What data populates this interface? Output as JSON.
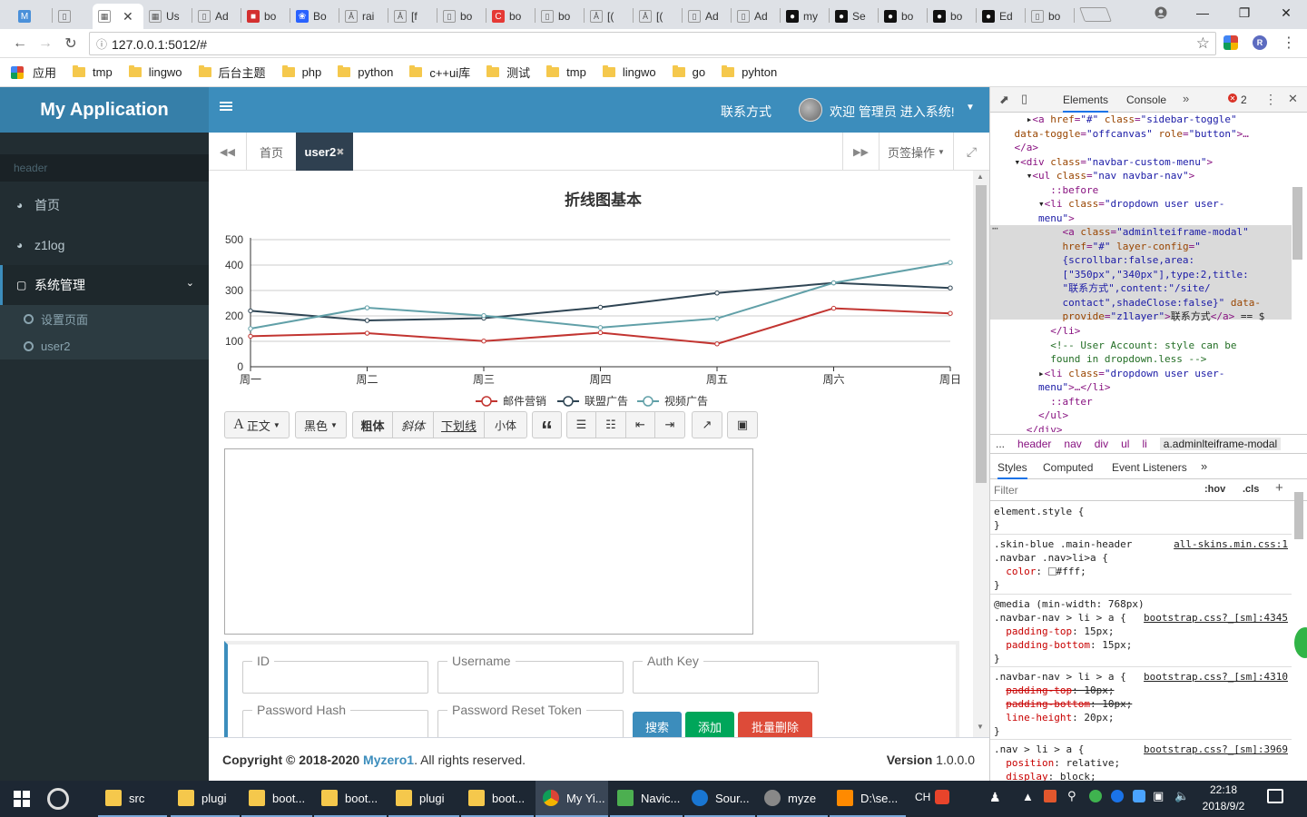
{
  "browser": {
    "tabs": [
      {
        "label": "",
        "icon": "m-logo-icon"
      },
      {
        "label": "",
        "icon": "page-icon"
      },
      {
        "label": "",
        "icon": "grid-icon",
        "active": true
      },
      {
        "label": "Us",
        "icon": "windows-icon"
      },
      {
        "label": "Ad",
        "icon": "page-icon"
      },
      {
        "label": "bo",
        "icon": "red-square-icon"
      },
      {
        "label": "Bo",
        "icon": "paw-icon"
      },
      {
        "label": "rai",
        "icon": "a-icon"
      },
      {
        "label": "[f",
        "icon": "a-icon"
      },
      {
        "label": "bo",
        "icon": "page-icon"
      },
      {
        "label": "bo",
        "icon": "c-red-icon"
      },
      {
        "label": "bo",
        "icon": "page-icon"
      },
      {
        "label": "[(",
        "icon": "a-icon"
      },
      {
        "label": "[(",
        "icon": "a-icon"
      },
      {
        "label": "Ad",
        "icon": "page-icon"
      },
      {
        "label": "Ad",
        "icon": "page-icon"
      },
      {
        "label": "my",
        "icon": "github-icon"
      },
      {
        "label": "Se",
        "icon": "github-icon"
      },
      {
        "label": "bo",
        "icon": "github-icon"
      },
      {
        "label": "bo",
        "icon": "github-icon"
      },
      {
        "label": "Ed",
        "icon": "github-icon"
      },
      {
        "label": "bo",
        "icon": "page-icon"
      }
    ],
    "url": "127.0.0.1:5012/#",
    "bookmarks": [
      {
        "label": "应用",
        "icon": "apps-icon"
      },
      {
        "label": "tmp"
      },
      {
        "label": "lingwo"
      },
      {
        "label": "后台主题"
      },
      {
        "label": "php"
      },
      {
        "label": "python"
      },
      {
        "label": "c++ui库"
      },
      {
        "label": "测试"
      },
      {
        "label": "tmp"
      },
      {
        "label": "lingwo"
      },
      {
        "label": "go"
      },
      {
        "label": "pyhton"
      }
    ]
  },
  "app": {
    "logo": "My Application",
    "nav_contact": "联系方式",
    "nav_user": "欢迎 管理员 进入系统!",
    "sidebar": {
      "header": "header",
      "items": [
        {
          "label": "首页",
          "icon": "dashboard-icon"
        },
        {
          "label": "z1log",
          "icon": "dashboard-icon"
        },
        {
          "label": "系统管理",
          "icon": "laptop-icon"
        }
      ],
      "subitems": [
        "设置页面",
        "user2"
      ]
    },
    "tabs": {
      "home": "首页",
      "active": "user2",
      "page_ops": "页签操作"
    },
    "editor": {
      "style_label": "正文",
      "color_label": "黑色",
      "bold": "粗体",
      "italic": "斜体",
      "underline": "下划线",
      "small": "小体",
      "quote": "“"
    },
    "form": {
      "fields": [
        "ID",
        "Username",
        "Auth Key",
        "Password Hash",
        "Password Reset Token"
      ],
      "search": "搜索",
      "add": "添加",
      "delete": "批量删除"
    },
    "footer": {
      "copyright_prefix": "Copyright © 2018-2020",
      "company": "Myzero1",
      "rights": ". All rights reserved.",
      "version_label": "Version",
      "version": "1.0.0.0"
    }
  },
  "chart_data": {
    "type": "line",
    "title": "折线图基本",
    "categories": [
      "周一",
      "周二",
      "周三",
      "周四",
      "周五",
      "周六",
      "周日"
    ],
    "ylim": [
      0,
      500
    ],
    "yticks": [
      0,
      100,
      200,
      300,
      400,
      500
    ],
    "grid": true,
    "legend_position": "bottom",
    "series": [
      {
        "name": "邮件营销",
        "color": "#c23531",
        "values": [
          120,
          132,
          101,
          134,
          90,
          230,
          210
        ]
      },
      {
        "name": "联盟广告",
        "color": "#2f4554",
        "values": [
          220,
          182,
          191,
          234,
          290,
          330,
          310
        ]
      },
      {
        "name": "视频广告",
        "color": "#61a0a8",
        "values": [
          150,
          232,
          201,
          154,
          190,
          330,
          410
        ]
      }
    ]
  },
  "devtools": {
    "tabs": [
      "Elements",
      "Console"
    ],
    "error_count": "2",
    "crumbs": [
      "...",
      "header",
      "nav",
      "div",
      "ul",
      "li",
      "a.adminlteiframe-modal"
    ],
    "style_tabs": [
      "Styles",
      "Computed",
      "Event Listeners"
    ],
    "filter_placeholder": "Filter",
    "hov": ":hov",
    "cls": ".cls"
  },
  "taskbar": {
    "items": [
      {
        "label": "src",
        "icon": "folder-icon"
      },
      {
        "label": "plugi",
        "icon": "folder-icon"
      },
      {
        "label": "boot...",
        "icon": "folder-icon"
      },
      {
        "label": "boot...",
        "icon": "folder-icon"
      },
      {
        "label": "plugi",
        "icon": "folder-icon"
      },
      {
        "label": "boot...",
        "icon": "folder-icon"
      },
      {
        "label": "My Yi...",
        "icon": "chrome-icon"
      },
      {
        "label": "Navic...",
        "icon": "navicat-icon"
      },
      {
        "label": "Sour...",
        "icon": "sourcetree-icon"
      },
      {
        "label": "myze",
        "icon": "avatar-icon"
      },
      {
        "label": "D:\\se...",
        "icon": "sublime-icon"
      }
    ],
    "ime": "CH",
    "time": "22:18",
    "date": "2018/9/2"
  }
}
